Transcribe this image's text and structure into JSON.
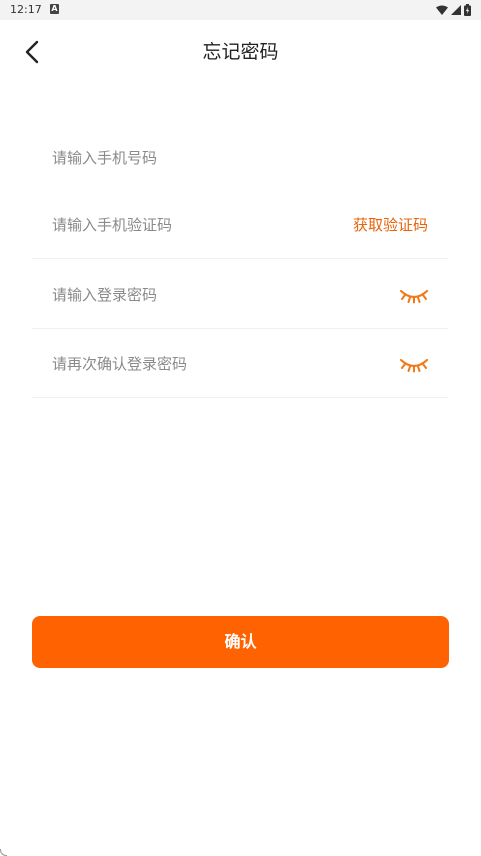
{
  "status_bar": {
    "time": "12:17",
    "notification_letter": "A",
    "icons": [
      "wifi-icon",
      "cell-signal-icon",
      "battery-charging-icon"
    ]
  },
  "header": {
    "back_icon": "chevron-left-icon",
    "title": "忘记密码"
  },
  "form": {
    "phone_placeholder": "请输入手机号码",
    "sms_placeholder": "请输入手机验证码",
    "get_code_label": "获取验证码",
    "password_placeholder": "请输入登录密码",
    "confirm_password_placeholder": "请再次确认登录密码",
    "eye_icon": "closed-eye-icon"
  },
  "confirm_label": "确认",
  "colors": {
    "accent": "#ff6200",
    "link": "#e8630a",
    "placeholder": "#8a8a8a",
    "divider": "#f0f0f0"
  }
}
